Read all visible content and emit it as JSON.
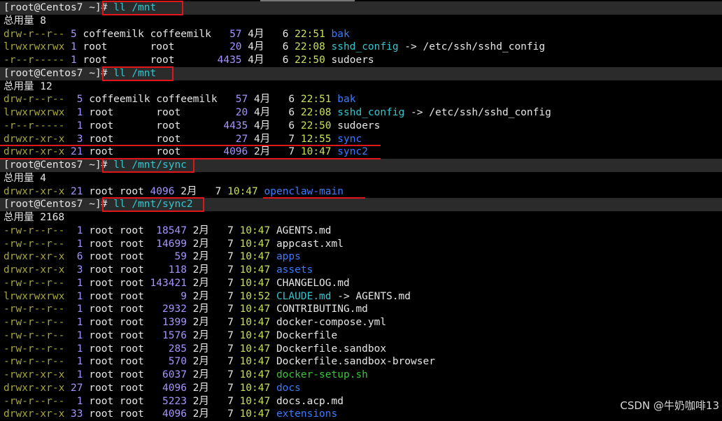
{
  "terminal": {
    "watermark": "CSDN @牛奶咖啡13",
    "lines": [
      {
        "type": "prompt",
        "prompt": "[root@Centos7 ~]# ",
        "cmd": "ll /mnt"
      },
      {
        "type": "total",
        "text": "总用量 8"
      },
      {
        "type": "file",
        "perm": "drw-r--r--",
        "links": " 5",
        "owner": "coffeemilk",
        "group": "coffeemilk",
        "size": "   57",
        "month": "4月",
        "day": "   6",
        "time": "22:51",
        "name": "bak",
        "kind": "dir"
      },
      {
        "type": "file",
        "perm": "lrwxrwxrwx",
        "links": " 1",
        "owner": "root      ",
        "group": "root      ",
        "size": "   20",
        "month": "4月",
        "day": "   6",
        "time": "22:08",
        "name": "sshd_config",
        "kind": "link",
        "target": " -> /etc/ssh/sshd_config"
      },
      {
        "type": "file",
        "perm": "-r--r-----",
        "links": " 1",
        "owner": "root      ",
        "group": "root      ",
        "size": " 4435",
        "month": "4月",
        "day": "   6",
        "time": "22:50",
        "name": "sudoers",
        "kind": "plain"
      },
      {
        "type": "prompt",
        "prompt": "[root@Centos7 ~]# ",
        "cmd": "ll /mnt"
      },
      {
        "type": "total",
        "text": "总用量 12"
      },
      {
        "type": "file",
        "perm": "drw-r--r--",
        "links": "  5",
        "owner": "coffeemilk",
        "group": "coffeemilk",
        "size": "   57",
        "month": "4月",
        "day": "   6",
        "time": "22:51",
        "name": "bak",
        "kind": "dir"
      },
      {
        "type": "file",
        "perm": "lrwxrwxrwx",
        "links": "  1",
        "owner": "root      ",
        "group": "root      ",
        "size": "   20",
        "month": "4月",
        "day": "   6",
        "time": "22:08",
        "name": "sshd_config",
        "kind": "link",
        "target": " -> /etc/ssh/sshd_config"
      },
      {
        "type": "file",
        "perm": "-r--r-----",
        "links": "  1",
        "owner": "root      ",
        "group": "root      ",
        "size": " 4435",
        "month": "4月",
        "day": "   6",
        "time": "22:50",
        "name": "sudoers",
        "kind": "plain"
      },
      {
        "type": "file",
        "perm": "drwxr-xr-x",
        "links": "  3",
        "owner": "root      ",
        "group": "root      ",
        "size": "   27",
        "month": "4月",
        "day": "   7",
        "time": "12:55",
        "name": "sync",
        "kind": "dir"
      },
      {
        "type": "file",
        "perm": "drwxr-xr-x",
        "links": " 21",
        "owner": "root      ",
        "group": "root      ",
        "size": " 4096",
        "month": "2月",
        "day": "   7",
        "time": "10:47",
        "name": "sync2",
        "kind": "dir"
      },
      {
        "type": "prompt",
        "prompt": "[root@Centos7 ~]# ",
        "cmd": "ll /mnt/sync"
      },
      {
        "type": "total",
        "text": "总用量 4"
      },
      {
        "type": "file",
        "perm": "drwxr-xr-x",
        "links": " 21",
        "owner": "root",
        "group": "root",
        "size": " 4096",
        "month": "2月",
        "day": "   7",
        "time": "10:47",
        "name": "openclaw-main",
        "kind": "dir"
      },
      {
        "type": "prompt",
        "prompt": "[root@Centos7 ~]# ",
        "cmd": "ll /mnt/sync2"
      },
      {
        "type": "total",
        "text": "总用量 2168"
      },
      {
        "type": "file",
        "perm": "-rw-r--r--",
        "links": "  1",
        "owner": "root",
        "group": "root",
        "size": "  18547",
        "month": "2月",
        "day": "   7",
        "time": "10:47",
        "name": "AGENTS.md",
        "kind": "plain"
      },
      {
        "type": "file",
        "perm": "-rw-r--r--",
        "links": "  1",
        "owner": "root",
        "group": "root",
        "size": "  14699",
        "month": "2月",
        "day": "   7",
        "time": "10:47",
        "name": "appcast.xml",
        "kind": "plain"
      },
      {
        "type": "file",
        "perm": "drwxr-xr-x",
        "links": "  6",
        "owner": "root",
        "group": "root",
        "size": "     59",
        "month": "2月",
        "day": "   7",
        "time": "10:47",
        "name": "apps",
        "kind": "dir"
      },
      {
        "type": "file",
        "perm": "drwxr-xr-x",
        "links": "  3",
        "owner": "root",
        "group": "root",
        "size": "    118",
        "month": "2月",
        "day": "   7",
        "time": "10:47",
        "name": "assets",
        "kind": "dir"
      },
      {
        "type": "file",
        "perm": "-rw-r--r--",
        "links": "  1",
        "owner": "root",
        "group": "root",
        "size": " 143421",
        "month": "2月",
        "day": "   7",
        "time": "10:47",
        "name": "CHANGELOG.md",
        "kind": "plain"
      },
      {
        "type": "file",
        "perm": "lrwxrwxrwx",
        "links": "  1",
        "owner": "root",
        "group": "root",
        "size": "      9",
        "month": "2月",
        "day": "   7",
        "time": "10:52",
        "name": "CLAUDE.md",
        "kind": "link",
        "target": " -> AGENTS.md"
      },
      {
        "type": "file",
        "perm": "-rw-r--r--",
        "links": "  1",
        "owner": "root",
        "group": "root",
        "size": "   2932",
        "month": "2月",
        "day": "   7",
        "time": "10:47",
        "name": "CONTRIBUTING.md",
        "kind": "plain"
      },
      {
        "type": "file",
        "perm": "-rw-r--r--",
        "links": "  1",
        "owner": "root",
        "group": "root",
        "size": "   1399",
        "month": "2月",
        "day": "   7",
        "time": "10:47",
        "name": "docker-compose.yml",
        "kind": "plain"
      },
      {
        "type": "file",
        "perm": "-rw-r--r--",
        "links": "  1",
        "owner": "root",
        "group": "root",
        "size": "   1576",
        "month": "2月",
        "day": "   7",
        "time": "10:47",
        "name": "Dockerfile",
        "kind": "plain"
      },
      {
        "type": "file",
        "perm": "-rw-r--r--",
        "links": "  1",
        "owner": "root",
        "group": "root",
        "size": "    285",
        "month": "2月",
        "day": "   7",
        "time": "10:47",
        "name": "Dockerfile.sandbox",
        "kind": "plain"
      },
      {
        "type": "file",
        "perm": "-rw-r--r--",
        "links": "  1",
        "owner": "root",
        "group": "root",
        "size": "    570",
        "month": "2月",
        "day": "   7",
        "time": "10:47",
        "name": "Dockerfile.sandbox-browser",
        "kind": "plain"
      },
      {
        "type": "file",
        "perm": "-rwxr-xr-x",
        "links": "  1",
        "owner": "root",
        "group": "root",
        "size": "   6037",
        "month": "2月",
        "day": "   7",
        "time": "10:47",
        "name": "docker-setup.sh",
        "kind": "exec"
      },
      {
        "type": "file",
        "perm": "drwxr-xr-x",
        "links": " 27",
        "owner": "root",
        "group": "root",
        "size": "   4096",
        "month": "2月",
        "day": "   7",
        "time": "10:47",
        "name": "docs",
        "kind": "dir"
      },
      {
        "type": "file",
        "perm": "-rw-r--r--",
        "links": "  1",
        "owner": "root",
        "group": "root",
        "size": "   5223",
        "month": "2月",
        "day": "   7",
        "time": "10:47",
        "name": "docs.acp.md",
        "kind": "plain"
      },
      {
        "type": "file",
        "perm": "drwxr-xr-x",
        "links": " 33",
        "owner": "root",
        "group": "root",
        "size": "   4096",
        "month": "2月",
        "day": "   7",
        "time": "10:47",
        "name": "extensions",
        "kind": "dir"
      }
    ]
  },
  "colors": {
    "highlight": "#e0161b",
    "directory": "#3b7bff",
    "symlink": "#34c6cf",
    "executable": "#3bc43b",
    "permissions": "#a6a639",
    "numbers": "#a893ff",
    "time": "#c7e05a"
  }
}
